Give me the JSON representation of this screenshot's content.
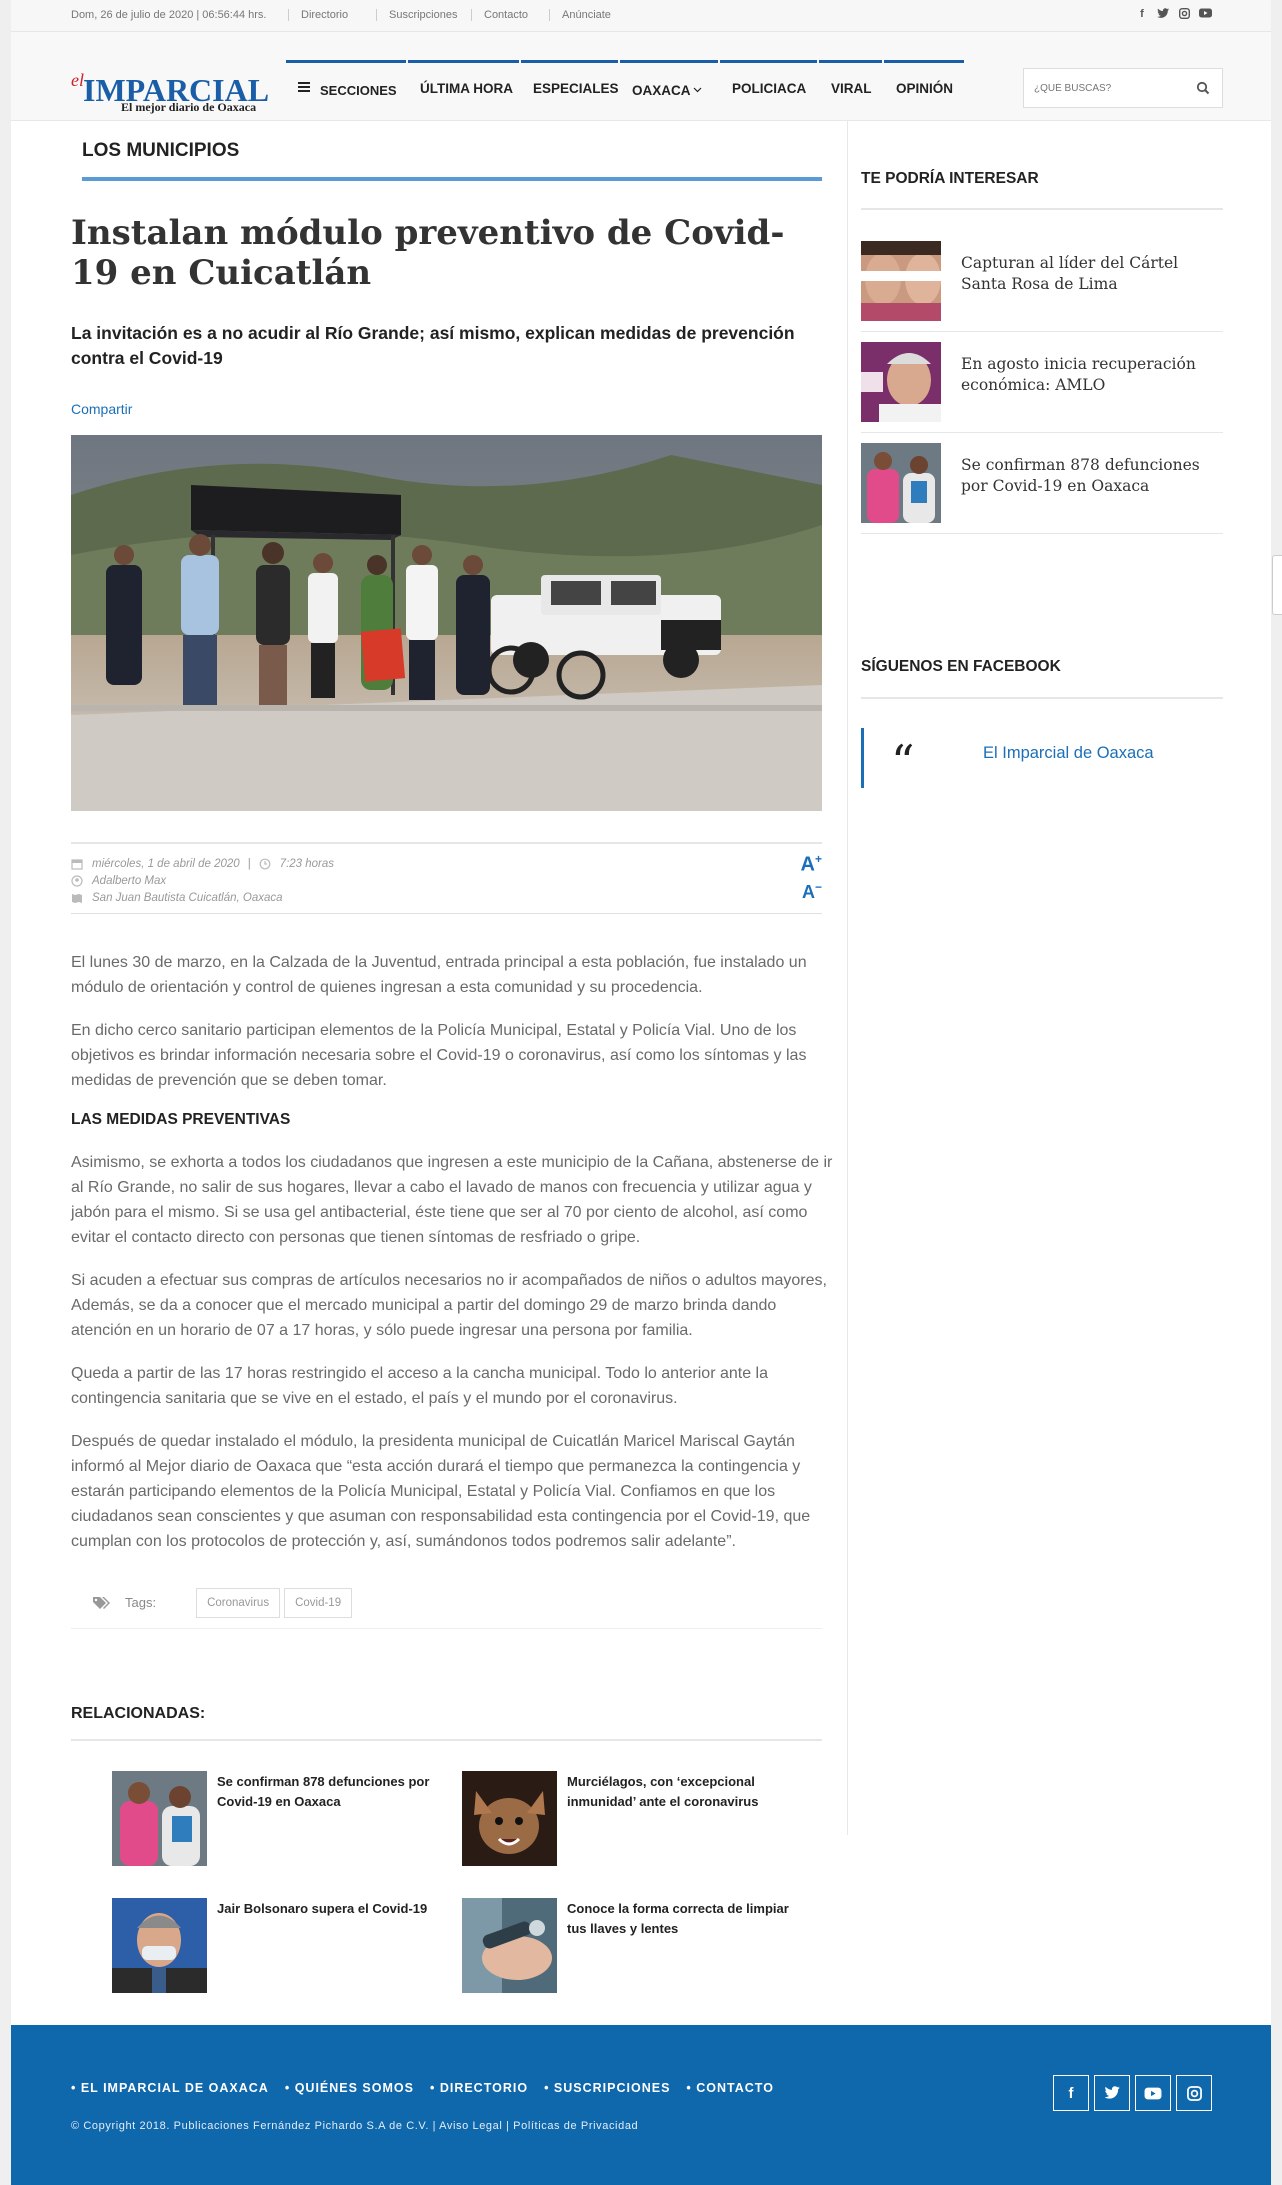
{
  "topbar": {
    "date": "Dom, 26 de julio de 2020 | 06:56:44 hrs.",
    "links": [
      "Directorio",
      "Suscripciones",
      "Contacto",
      "Anúnciate"
    ],
    "social_icons": [
      "facebook-icon",
      "twitter-icon",
      "instagram-icon",
      "youtube-icon"
    ]
  },
  "logo": {
    "el": "el",
    "name": "IMPARCIAL",
    "tagline": "El mejor diario de Oaxaca"
  },
  "nav": {
    "sections": "SECCIONES",
    "items": [
      "ÚLTIMA HORA",
      "ESPECIALES",
      "OAXACA",
      "POLICIACA",
      "VIRAL",
      "OPINIÓN"
    ]
  },
  "search": {
    "placeholder": "¿QUÉ BUSCAS?"
  },
  "article": {
    "section": "LOS MUNICIPIOS",
    "title": "Instalan módulo preventivo de Covid-19 en Cuicatlán",
    "subtitle": "La invitación es a no acudir al Río Grande; así mismo, explican medidas de prevención contra el Covid-19",
    "share": "Compartir",
    "date": "miércoles, 1 de abril de 2020",
    "time": "7:23 horas",
    "author": "Adalberto Max",
    "location": "San Juan Bautista Cuicatlán, Oaxaca",
    "font_up": "A",
    "font_down": "A",
    "p1": "El lunes 30 de marzo, en la Calzada de la Juventud, entrada principal a esta población, fue instalado un módulo de orientación y control de quienes ingresan a esta comunidad y su procedencia.",
    "p2": "En dicho cerco sanitario participan elementos de la Policía Municipal, Estatal y Policía Vial. Uno de los objetivos es brindar información necesaria sobre el Covid-19 o coronavirus, así como los síntomas y las medidas de prevención que se deben tomar.",
    "h3": "LAS MEDIDAS PREVENTIVAS",
    "p3": "Asimismo, se exhorta a todos los ciudadanos que ingresen a este municipio de la Cañana, abstenerse de ir al Río Grande, no salir de sus hogares, llevar a cabo el lavado de manos con frecuencia y utilizar agua y jabón para el mismo. Si se usa gel antibacterial, éste tiene que ser al 70 por ciento de alcohol, así como evitar el contacto directo con personas que tienen síntomas de resfriado o gripe.",
    "p4": "Si acuden a efectuar sus compras de artículos necesarios no ir acompañados de niños o adultos mayores, Además, se da a conocer que el mercado municipal a partir del domingo 29 de marzo brinda dando atención en un horario de 07 a 17 horas, y sólo puede ingresar una persona por familia.",
    "p5": "Queda a partir de las 17 horas restringido el acceso a la cancha municipal. Todo lo anterior ante la contingencia sanitaria que se vive en el estado, el país y el mundo por el coronavirus.",
    "p6": "Después de quedar instalado el módulo, la presidenta municipal de Cuicatlán Maricel Mariscal Gaytán informó al Mejor diario de Oaxaca que “esta acción durará el tiempo que permanezca la contingencia y estarán participando elementos de la Policía Municipal, Estatal y Policía Vial. Confiamos en que los ciudadanos sean conscientes y que asuman con responsabilidad esta contingencia por el Covid-19, que cumplan con los protocolos de protección y, así, sumándonos todos podremos salir adelante”.",
    "tags_label": "Tags:",
    "tags": [
      "Coronavirus",
      "Covid-19"
    ]
  },
  "related": {
    "title": "RELACIONADAS:",
    "items": [
      "Se confirman 878 defunciones por Covid-19 en Oaxaca",
      "Murciélagos, con ‘excepcional inmunidad’ ante el coronavirus",
      "Jair Bolsonaro supera el Covid-19",
      "Conoce la forma correcta de limpiar tus llaves y lentes"
    ]
  },
  "sidebar": {
    "interest_title": "TE PODRÍA INTERESAR",
    "items": [
      "Capturan al líder del Cártel Santa Rosa de Lima",
      "En agosto inicia recuperación económica: AMLO",
      "Se confirman 878 defunciones por Covid-19 en Oaxaca"
    ],
    "facebook_title": "SÍGUENOS EN FACEBOOK",
    "facebook_quote": "“",
    "facebook_name": "El Imparcial de Oaxaca"
  },
  "footer": {
    "links": [
      "• EL IMPARCIAL DE OAXACA",
      "• QUIÉNES SOMOS",
      "• DIRECTORIO",
      "• SUSCRIPCIONES",
      "• CONTACTO"
    ],
    "copyright": "© Copyright 2018. Publicaciones Fernández Pichardo S.A de C.V. | Aviso Legal | Políticas de Privacidad",
    "social": [
      "f",
      "t",
      "▶",
      "◎"
    ]
  },
  "colors": {
    "brand_blue": "#1b5ea8",
    "footer_blue": "#0f67ac",
    "accent_line": "#5b9bd5",
    "logo_red": "#d0202a"
  }
}
